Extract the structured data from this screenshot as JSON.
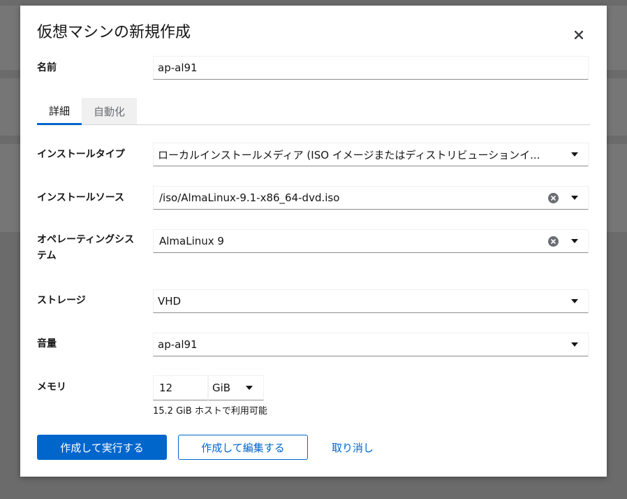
{
  "dialog": {
    "title": "仮想マシンの新規作成"
  },
  "name_field": {
    "label": "名前",
    "value": "ap-al91"
  },
  "tabs": [
    {
      "label": "詳細",
      "active": true
    },
    {
      "label": "自動化",
      "active": false
    }
  ],
  "install_type": {
    "label": "インストールタイプ",
    "value": "ローカルインストールメディア (ISO イメージまたはディストリビューションイ..."
  },
  "install_source": {
    "label": "インストールソース",
    "value": "/iso/AlmaLinux-9.1-x86_64-dvd.iso"
  },
  "os": {
    "label_line1": "オペレーティングシス",
    "label_line2": "テム",
    "value": "AlmaLinux 9"
  },
  "storage": {
    "label": "ストレージ",
    "value": "VHD"
  },
  "volume": {
    "label": "音量",
    "value": "ap-al91"
  },
  "memory": {
    "label": "メモリ",
    "value": "12",
    "unit": "GiB",
    "helper": "15.2 GiB ホストで利用可能"
  },
  "buttons": {
    "create_run": "作成して実行する",
    "create_edit": "作成して編集する",
    "cancel": "取り消し"
  },
  "colors": {
    "primary": "#0066cc",
    "overlay": "#6a6a6a"
  }
}
